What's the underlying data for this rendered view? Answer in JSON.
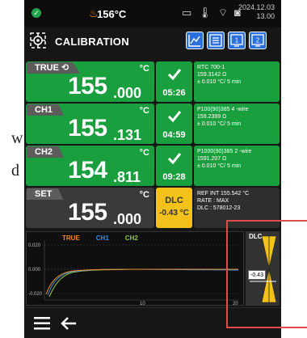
{
  "status": {
    "temperature": "156°C",
    "date": "2024.12.03",
    "time": "13.00"
  },
  "title": "CALIBRATION",
  "channels": [
    {
      "tag": "TRUE",
      "unit": "°C",
      "value_big": "155",
      "value_small": ".000",
      "stab_time": "05:26",
      "info": [
        "RTC 700-1",
        "159.3142 Ω",
        "± 0.010 °C/ 5 min"
      ]
    },
    {
      "tag": "CH1",
      "unit": "°C",
      "value_big": "155",
      "value_small": ".131",
      "stab_time": "04:59",
      "info": [
        "P100(90)385 4 -wire",
        "159.2399 Ω",
        "± 0.010 °C/ 5 min"
      ]
    },
    {
      "tag": "CH2",
      "unit": "°C",
      "value_big": "154",
      "value_small": ".811",
      "stab_time": "09:28",
      "info": [
        "P1000(90)385 2 -wire",
        "1591.207 Ω",
        "± 0.010 °C/ 5 min"
      ]
    }
  ],
  "set": {
    "tag": "SET",
    "unit": "°C",
    "value_big": "155",
    "value_small": ".000",
    "dlc_title": "DLC",
    "dlc_value": "-0.43 °C",
    "info": [
      "REF INT 155.542 °C",
      "RATE : MAX",
      "DLC : 578012-23"
    ]
  },
  "plot": {
    "legend": [
      {
        "name": "TRUE",
        "color": "#f08a24"
      },
      {
        "name": "CH1",
        "color": "#3a8fe0"
      },
      {
        "name": "CH2",
        "color": "#8ec63f"
      }
    ],
    "y_ticks": [
      "0.020",
      "0.000",
      "-0.020"
    ],
    "x_ticks": [
      "10",
      "20"
    ],
    "dlc_label": "DLC",
    "dlc_value": "-0.43"
  },
  "colors": {
    "green": "#1a9f3e",
    "yellow": "#f2c21a",
    "blue": "#2a6fdb"
  }
}
